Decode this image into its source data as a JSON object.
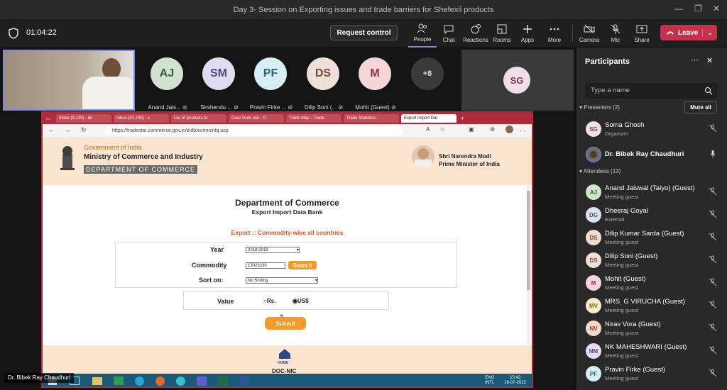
{
  "window": {
    "title": "Day 3- Session on Exporting issues and trade barriers for Shefexil products"
  },
  "toolbar": {
    "timer": "01:04:22",
    "request_control": "Request control",
    "buttons": [
      {
        "label": "People",
        "icon": "people-icon"
      },
      {
        "label": "Chat",
        "icon": "chat-icon"
      },
      {
        "label": "Reactions",
        "icon": "reactions-icon"
      },
      {
        "label": "Rooms",
        "icon": "rooms-icon"
      },
      {
        "label": "Apps",
        "icon": "apps-icon"
      },
      {
        "label": "More",
        "icon": "more-icon"
      }
    ],
    "camera": "Camera",
    "mic": "Mic",
    "share": "Share",
    "leave": "Leave"
  },
  "stage": {
    "tiles": [
      {
        "initials": "AJ",
        "name": "Anand Jais...",
        "color": "#cfe3cf",
        "fg": "#3a5c3a"
      },
      {
        "initials": "SM",
        "name": "Sirshendu ...",
        "color": "#e0dcf1",
        "fg": "#4e4680"
      },
      {
        "initials": "PF",
        "name": "Pravin Firke ...",
        "color": "#d6eef3",
        "fg": "#2c6470"
      },
      {
        "initials": "DS",
        "name": "Dilip Soni (...",
        "color": "#efdfd9",
        "fg": "#7a4a3a"
      },
      {
        "initials": "M",
        "name": "Mohit (Guest)",
        "color": "#f5d5d8",
        "fg": "#8a3340"
      }
    ],
    "overflow": "+8",
    "large_tile": "SG",
    "presenter_label": "Dr. Bibek Ray Chaudhuri"
  },
  "browser": {
    "tabs": [
      "Inbox (9,129) - bri",
      "Inbox (31,740) - s",
      "List of products fa",
      "Guar Gum use - G",
      "Trade Map - Trade",
      "Trade Statistics -",
      "Export Import Dat"
    ],
    "url": "https://tradestat.commerce.gov.in/eidb/ecomcntq.asp"
  },
  "site": {
    "gov": "Government of India",
    "ministry": "Ministry of Commerce and Industry",
    "dept": "DEPARTMENT OF COMMERCE",
    "pm_name": "Shri Narendra Modi",
    "pm_title": "Prime Minister of India",
    "title": "Department of Commerce",
    "subtitle": "Export Import Data Bank",
    "section": "Export :: Commodity-wise all countries",
    "year_label": "Year",
    "year_value": "2018-2019",
    "commodity_label": "Commodity",
    "commodity_value": "13023230",
    "search": "Search",
    "sort_label": "Sort on:",
    "sort_value": "No Sorting",
    "value_label": "Value",
    "rs": "Rs.",
    "usd": "US$",
    "submit": "Submit",
    "home": "HOME",
    "footer": "DOC-NIC"
  },
  "taskbar": {
    "lang": "ENG",
    "region": "INTL",
    "time": "15:42",
    "date": "16-07-2022"
  },
  "panel": {
    "title": "Participants",
    "search_placeholder": "Type a name",
    "presenters_header": "Presenters (2)",
    "mute_all": "Mute all",
    "attendees_header": "Attendees (13)",
    "presenters": [
      {
        "initials": "SG",
        "name": "Soma Ghosh",
        "role": "Organizer",
        "color": "#efdfe6",
        "fg": "#7a3a55"
      },
      {
        "initials": "",
        "name": "Dr. Bibek Ray Chaudhuri",
        "role": "",
        "color": "#6b6b6b",
        "fg": "#fff"
      }
    ],
    "attendees": [
      {
        "initials": "AJ",
        "name": "Anand Jaiswal (Taiyo) (Guest)",
        "role": "Meeting guest",
        "color": "#cfe3cf",
        "fg": "#3a5c3a"
      },
      {
        "initials": "DG",
        "name": "Dheeraj Goyal",
        "role": "External",
        "color": "#dde3f1",
        "fg": "#3c4d80"
      },
      {
        "initials": "DS",
        "name": "Dilip Kumar Sarda (Guest)",
        "role": "Meeting guest",
        "color": "#f2dccf",
        "fg": "#7a4a2a"
      },
      {
        "initials": "DS",
        "name": "Dilip Soni (Guest)",
        "role": "Meeting guest",
        "color": "#efdfd9",
        "fg": "#7a4a3a"
      },
      {
        "initials": "M",
        "name": "Mohit (Guest)",
        "role": "Meeting guest",
        "color": "#f5d5d8",
        "fg": "#8a3340"
      },
      {
        "initials": "MV",
        "name": "MRS. G VIRUCHA (Guest)",
        "role": "Meeting guest",
        "color": "#f5ecc8",
        "fg": "#7a6420"
      },
      {
        "initials": "NV",
        "name": "Nirav Vora (Guest)",
        "role": "Meeting guest",
        "color": "#f7d9c9",
        "fg": "#8a4020"
      },
      {
        "initials": "NM",
        "name": "NK MAHESHWARI (Guest)",
        "role": "Meeting guest",
        "color": "#e6dcef",
        "fg": "#5a3c80"
      },
      {
        "initials": "PF",
        "name": "Pravin Firke (Guest)",
        "role": "Meeting guest",
        "color": "#d6eef3",
        "fg": "#2c6470"
      }
    ]
  }
}
